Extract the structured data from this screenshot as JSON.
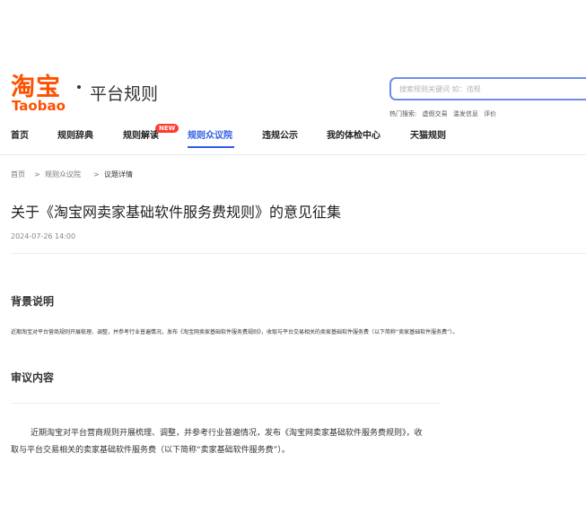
{
  "brand": {
    "logo_cn": "淘宝",
    "logo_en": "Taobao",
    "site_title": "平台规则",
    "brand_color": "#ff5000"
  },
  "search": {
    "placeholder": "搜索规则关键词 如：违规",
    "hot_label": "热门搜索:",
    "hot_terms": [
      "虚假交易",
      "滥发信息",
      "评价"
    ]
  },
  "nav": {
    "items": [
      "首页",
      "规则辞典",
      "规则解读",
      "规则众议院",
      "违规公示",
      "我的体检中心",
      "天猫规则"
    ],
    "active": "规则众议院",
    "new_badge": "NEW",
    "accent_color": "#2f5de0"
  },
  "breadcrumb": {
    "items": [
      "首页",
      "规则众议院",
      "议题详情"
    ],
    "separator": ">"
  },
  "article": {
    "title": "关于《淘宝网卖家基础软件服务费规则》的意见征集",
    "date": "2024-07-26 14:00",
    "background_heading": "背景说明",
    "background_text": "近期淘宝对平台营商规则开展梳理、调整，并参考行业普遍情况，发布《淘宝网卖家基础软件服务费规则》，收取与平台交易相关的卖家基础软件服务费（以下简称“卖家基础软件服务费”）。",
    "content_heading": "审议内容",
    "content_text": "近期淘宝对平台营商规则开展梳理、调整，并参考行业普遍情况，发布《淘宝网卖家基础软件服务费规则》，收取与平台交易相关的卖家基础软件服务费（以下简称“卖家基础软件服务费”）。"
  }
}
